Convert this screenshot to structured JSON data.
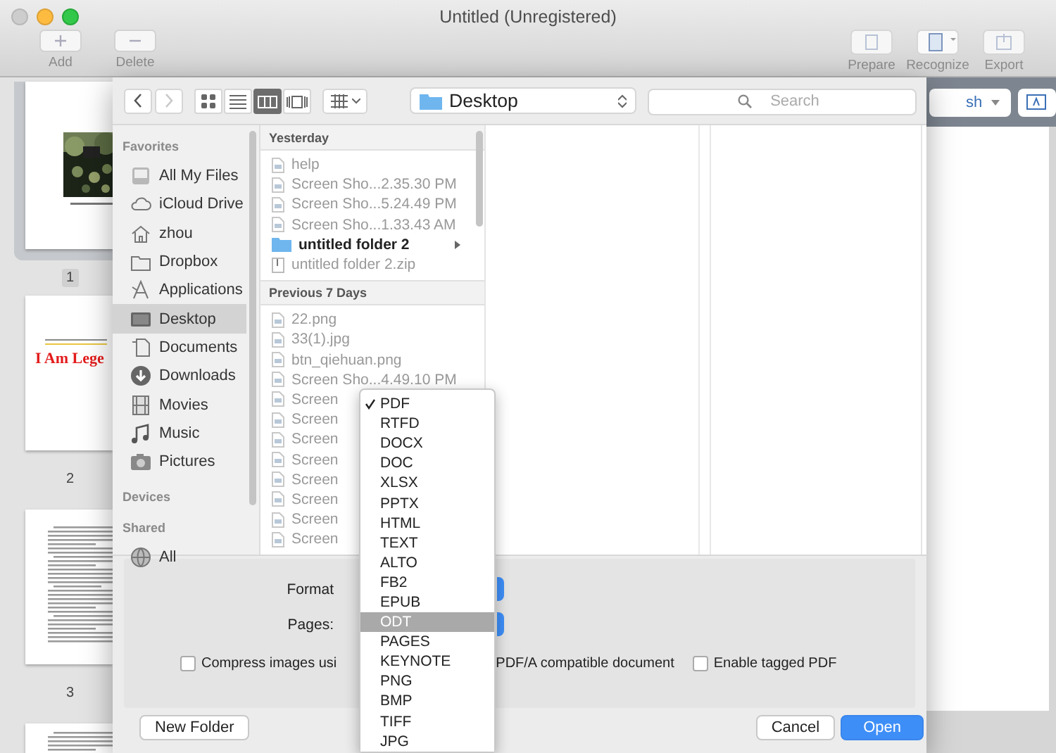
{
  "window": {
    "title": "Untitled (Unregistered)"
  },
  "toolbar": {
    "left": [
      {
        "label": "Add",
        "kind": "add"
      },
      {
        "label": "Delete",
        "kind": "delete"
      }
    ],
    "right": [
      {
        "label": "Prepare",
        "kind": "prepare"
      },
      {
        "label": "Recognize",
        "kind": "recognize"
      },
      {
        "label": "Export",
        "kind": "export"
      }
    ]
  },
  "pages": [
    {
      "number": "1",
      "selected": true
    },
    {
      "number": "2",
      "selected": false,
      "kind": "title",
      "title": "I Am Lege"
    },
    {
      "number": "3",
      "selected": false,
      "kind": "text"
    },
    {
      "selected": false,
      "kind": "text"
    }
  ],
  "side_panel": {
    "language": "sh"
  },
  "dialog": {
    "nav": [
      {
        "kind": "back",
        "disabled": false
      },
      {
        "kind": "forward",
        "disabled": true
      }
    ],
    "views": [
      {
        "kind": "icons",
        "selected": false
      },
      {
        "kind": "list",
        "selected": false
      },
      {
        "kind": "columns",
        "selected": true
      },
      {
        "kind": "coverflow",
        "selected": false
      }
    ],
    "location": "Desktop",
    "search": {
      "placeholder": "Search"
    },
    "sidebar": [
      {
        "heading": "Favorites",
        "items": [
          {
            "label": "All My Files",
            "kind": "allfiles",
            "selected": false
          },
          {
            "label": "iCloud Drive",
            "kind": "cloud",
            "selected": false
          },
          {
            "label": "zhou",
            "kind": "home",
            "selected": false
          },
          {
            "label": "Dropbox",
            "kind": "folder",
            "selected": false
          },
          {
            "label": "Applications",
            "kind": "apps",
            "selected": false
          },
          {
            "label": "Desktop",
            "kind": "desktop",
            "selected": true
          },
          {
            "label": "Documents",
            "kind": "documents",
            "selected": false
          },
          {
            "label": "Downloads",
            "kind": "downloads",
            "selected": false
          },
          {
            "label": "Movies",
            "kind": "movies",
            "selected": false
          },
          {
            "label": "Music",
            "kind": "music",
            "selected": false
          },
          {
            "label": "Pictures",
            "kind": "pictures",
            "selected": false
          }
        ]
      },
      {
        "heading": "Devices"
      },
      {
        "heading": "Shared",
        "items": [
          {
            "label": "All",
            "kind": "network",
            "selected": false
          }
        ]
      }
    ],
    "groups": [
      {
        "heading": "Yesterday",
        "items": [
          {
            "name": "help",
            "kind": "file",
            "disabled": true
          },
          {
            "name": "Screen Sho...2.35.30 PM",
            "kind": "file",
            "disabled": true
          },
          {
            "name": "Screen Sho...5.24.49 PM",
            "kind": "file",
            "disabled": true
          },
          {
            "name": "Screen Sho...1.33.43 AM",
            "kind": "file",
            "disabled": true
          },
          {
            "name": "untitled folder 2",
            "kind": "folder",
            "disabled": false
          },
          {
            "name": "untitled folder 2.zip",
            "kind": "zip",
            "disabled": true
          }
        ]
      },
      {
        "heading": "Previous 7 Days",
        "items": [
          {
            "name": "22.png",
            "kind": "file",
            "disabled": true
          },
          {
            "name": "33(1).jpg",
            "kind": "file",
            "disabled": true
          },
          {
            "name": "btn_qiehuan.png",
            "kind": "file",
            "disabled": true
          },
          {
            "name": "Screen Sho...4.49.10 PM",
            "kind": "file",
            "disabled": true
          },
          {
            "name": "Screen",
            "kind": "file",
            "disabled": true
          },
          {
            "name": "Screen",
            "kind": "file",
            "disabled": true
          },
          {
            "name": "Screen",
            "kind": "file",
            "disabled": true
          },
          {
            "name": "Screen",
            "kind": "file",
            "disabled": true
          },
          {
            "name": "Screen",
            "kind": "file",
            "disabled": true
          },
          {
            "name": "Screen",
            "kind": "file",
            "disabled": true
          },
          {
            "name": "Screen",
            "kind": "file",
            "disabled": true
          },
          {
            "name": "Screen",
            "kind": "file",
            "disabled": true
          }
        ]
      }
    ]
  },
  "options": {
    "format_label": "Format",
    "pages_label": "Pages:",
    "checkboxes": [
      {
        "label": "Compress images usi",
        "checked": false
      },
      {
        "label": "PDF/A compatible document"
      },
      {
        "label": "Enable tagged PDF",
        "checked": false
      }
    ]
  },
  "buttons": [
    {
      "label": "New Folder",
      "kind": "left"
    },
    {
      "label": "Cancel",
      "kind": "normal"
    },
    {
      "label": "Open",
      "kind": "default"
    }
  ],
  "format_menu": [
    {
      "label": "PDF",
      "checked": true,
      "selected": false
    },
    {
      "label": "RTFD",
      "checked": false,
      "selected": false
    },
    {
      "label": "DOCX",
      "checked": false,
      "selected": false
    },
    {
      "label": "DOC",
      "checked": false,
      "selected": false
    },
    {
      "label": "XLSX",
      "checked": false,
      "selected": false
    },
    {
      "label": "PPTX",
      "checked": false,
      "selected": false
    },
    {
      "label": "HTML",
      "checked": false,
      "selected": false
    },
    {
      "label": "TEXT",
      "checked": false,
      "selected": false
    },
    {
      "label": "ALTO",
      "checked": false,
      "selected": false
    },
    {
      "label": "FB2",
      "checked": false,
      "selected": false
    },
    {
      "label": "EPUB",
      "checked": false,
      "selected": false
    },
    {
      "label": "ODT",
      "checked": false,
      "selected": true
    },
    {
      "label": "PAGES",
      "checked": false,
      "selected": false
    },
    {
      "label": "KEYNOTE",
      "checked": false,
      "selected": false
    },
    {
      "label": "PNG",
      "checked": false,
      "selected": false
    },
    {
      "label": "BMP",
      "checked": false,
      "selected": false
    },
    {
      "label": "TIFF",
      "checked": false,
      "selected": false
    },
    {
      "label": "JPG",
      "checked": false,
      "selected": false
    }
  ]
}
